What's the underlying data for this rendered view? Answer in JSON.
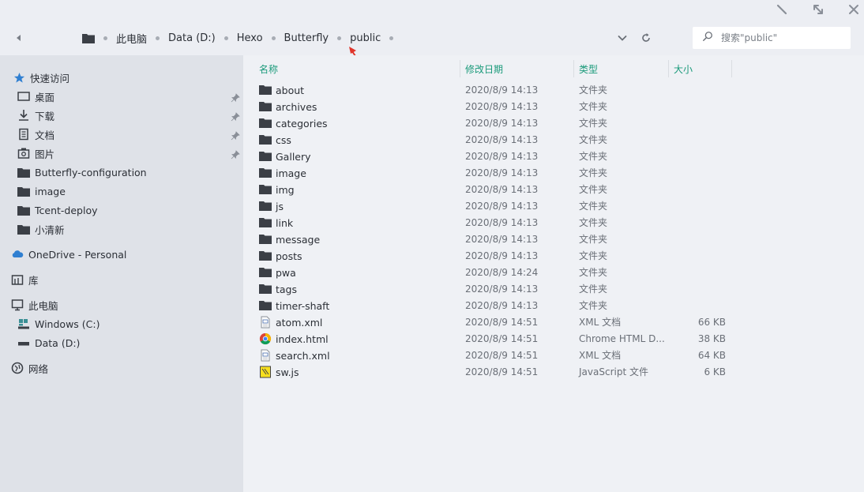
{
  "breadcrumb": [
    "此电脑",
    "Data (D:)",
    "Hexo",
    "Butterfly",
    "public"
  ],
  "search": {
    "placeholder": "搜索\"public\""
  },
  "sidebar": {
    "quick_access": "快速访问",
    "items": [
      {
        "label": "桌面",
        "icon": "desktop-icon",
        "pinned": true
      },
      {
        "label": "下载",
        "icon": "download-icon",
        "pinned": true
      },
      {
        "label": "文档",
        "icon": "document-icon",
        "pinned": true
      },
      {
        "label": "图片",
        "icon": "pictures-icon",
        "pinned": true
      },
      {
        "label": "Butterfly-configuration",
        "icon": "folder-icon",
        "pinned": false
      },
      {
        "label": "image",
        "icon": "folder-icon",
        "pinned": false
      },
      {
        "label": "Tcent-deploy",
        "icon": "folder-icon",
        "pinned": false
      },
      {
        "label": "小清新",
        "icon": "folder-icon",
        "pinned": false
      }
    ],
    "onedrive": "OneDrive - Personal",
    "library": "库",
    "this_pc": "此电脑",
    "drives": [
      "Windows (C:)",
      "Data (D:)"
    ],
    "network": "网络"
  },
  "columns": {
    "name": "名称",
    "date": "修改日期",
    "type": "类型",
    "size": "大小"
  },
  "files": [
    {
      "name": "about",
      "date": "2020/8/9 14:13",
      "type": "文件夹",
      "size": "",
      "icon": "folder-icon"
    },
    {
      "name": "archives",
      "date": "2020/8/9 14:13",
      "type": "文件夹",
      "size": "",
      "icon": "folder-icon"
    },
    {
      "name": "categories",
      "date": "2020/8/9 14:13",
      "type": "文件夹",
      "size": "",
      "icon": "folder-icon"
    },
    {
      "name": "css",
      "date": "2020/8/9 14:13",
      "type": "文件夹",
      "size": "",
      "icon": "folder-icon"
    },
    {
      "name": "Gallery",
      "date": "2020/8/9 14:13",
      "type": "文件夹",
      "size": "",
      "icon": "folder-icon"
    },
    {
      "name": "image",
      "date": "2020/8/9 14:13",
      "type": "文件夹",
      "size": "",
      "icon": "folder-icon"
    },
    {
      "name": "img",
      "date": "2020/8/9 14:13",
      "type": "文件夹",
      "size": "",
      "icon": "folder-icon"
    },
    {
      "name": "js",
      "date": "2020/8/9 14:13",
      "type": "文件夹",
      "size": "",
      "icon": "folder-icon"
    },
    {
      "name": "link",
      "date": "2020/8/9 14:13",
      "type": "文件夹",
      "size": "",
      "icon": "folder-icon"
    },
    {
      "name": "message",
      "date": "2020/8/9 14:13",
      "type": "文件夹",
      "size": "",
      "icon": "folder-icon"
    },
    {
      "name": "posts",
      "date": "2020/8/9 14:13",
      "type": "文件夹",
      "size": "",
      "icon": "folder-icon"
    },
    {
      "name": "pwa",
      "date": "2020/8/9 14:24",
      "type": "文件夹",
      "size": "",
      "icon": "folder-icon"
    },
    {
      "name": "tags",
      "date": "2020/8/9 14:13",
      "type": "文件夹",
      "size": "",
      "icon": "folder-icon"
    },
    {
      "name": "timer-shaft",
      "date": "2020/8/9 14:13",
      "type": "文件夹",
      "size": "",
      "icon": "folder-icon"
    },
    {
      "name": "atom.xml",
      "date": "2020/8/9 14:51",
      "type": "XML 文档",
      "size": "66 KB",
      "icon": "xml-file-icon"
    },
    {
      "name": "index.html",
      "date": "2020/8/9 14:51",
      "type": "Chrome HTML D...",
      "size": "38 KB",
      "icon": "chrome-html-icon"
    },
    {
      "name": "search.xml",
      "date": "2020/8/9 14:51",
      "type": "XML 文档",
      "size": "64 KB",
      "icon": "xml-file-icon"
    },
    {
      "name": "sw.js",
      "date": "2020/8/9 14:51",
      "type": "JavaScript 文件",
      "size": "6 KB",
      "icon": "js-file-icon"
    }
  ],
  "colors": {
    "accent": "#1a9a7a",
    "sidebar_bg": "#dfe2e8",
    "main_bg": "#eff1f5",
    "pointer_arrow": "#e0352b"
  }
}
